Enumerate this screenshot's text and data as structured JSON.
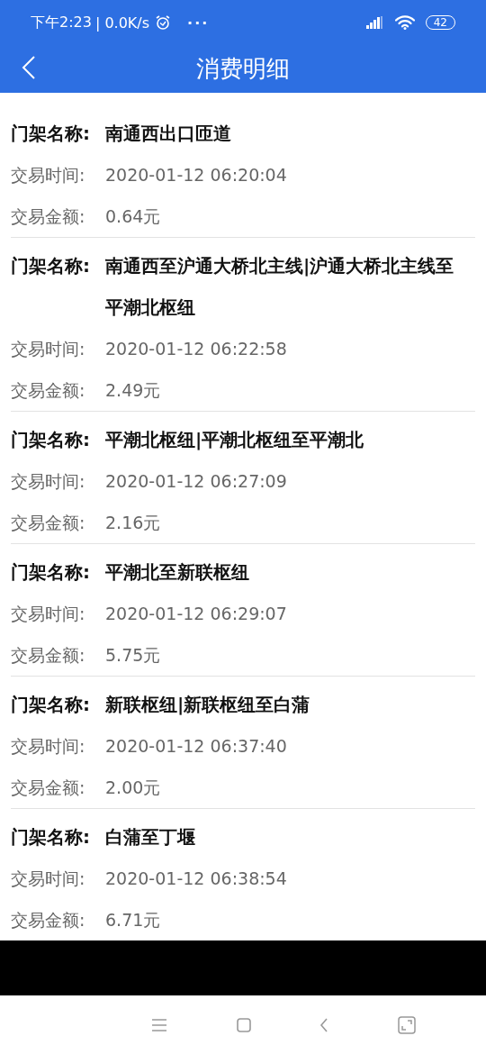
{
  "status_bar": {
    "time": "下午2:23",
    "speed": "| 0.0K/s",
    "more": "···",
    "battery": "42"
  },
  "header": {
    "title": "消费明细"
  },
  "records": [
    {
      "fields": [
        {
          "kind": "name",
          "label": "门架名称:",
          "value": "南通西出口匝道"
        },
        {
          "kind": "detail",
          "label": "交易时间:",
          "value": "2020-01-12 06:20:04"
        },
        {
          "kind": "detail",
          "label": "交易金额:",
          "value": "0.64元"
        }
      ]
    },
    {
      "fields": [
        {
          "kind": "name",
          "label": "门架名称:",
          "value": "南通西至沪通大桥北主线|沪通大桥北主线至平潮北枢纽"
        },
        {
          "kind": "detail",
          "label": "交易时间:",
          "value": "2020-01-12 06:22:58"
        },
        {
          "kind": "detail",
          "label": "交易金额:",
          "value": "2.49元"
        }
      ]
    },
    {
      "fields": [
        {
          "kind": "name",
          "label": "门架名称:",
          "value": "平潮北枢纽|平潮北枢纽至平潮北"
        },
        {
          "kind": "detail",
          "label": "交易时间:",
          "value": "2020-01-12 06:27:09"
        },
        {
          "kind": "detail",
          "label": "交易金额:",
          "value": "2.16元"
        }
      ]
    },
    {
      "fields": [
        {
          "kind": "name",
          "label": "门架名称:",
          "value": "平潮北至新联枢纽"
        },
        {
          "kind": "detail",
          "label": "交易时间:",
          "value": "2020-01-12 06:29:07"
        },
        {
          "kind": "detail",
          "label": "交易金额:",
          "value": "5.75元"
        }
      ]
    },
    {
      "fields": [
        {
          "kind": "name",
          "label": "门架名称:",
          "value": "新联枢纽|新联枢纽至白蒲"
        },
        {
          "kind": "detail",
          "label": "交易时间:",
          "value": "2020-01-12 06:37:40"
        },
        {
          "kind": "detail",
          "label": "交易金额:",
          "value": "2.00元"
        }
      ]
    },
    {
      "fields": [
        {
          "kind": "name",
          "label": "门架名称:",
          "value": "白蒲至丁堰"
        },
        {
          "kind": "detail",
          "label": "交易时间:",
          "value": "2020-01-12 06:38:54"
        },
        {
          "kind": "detail",
          "label": "交易金额:",
          "value": "6.71元"
        }
      ]
    }
  ]
}
